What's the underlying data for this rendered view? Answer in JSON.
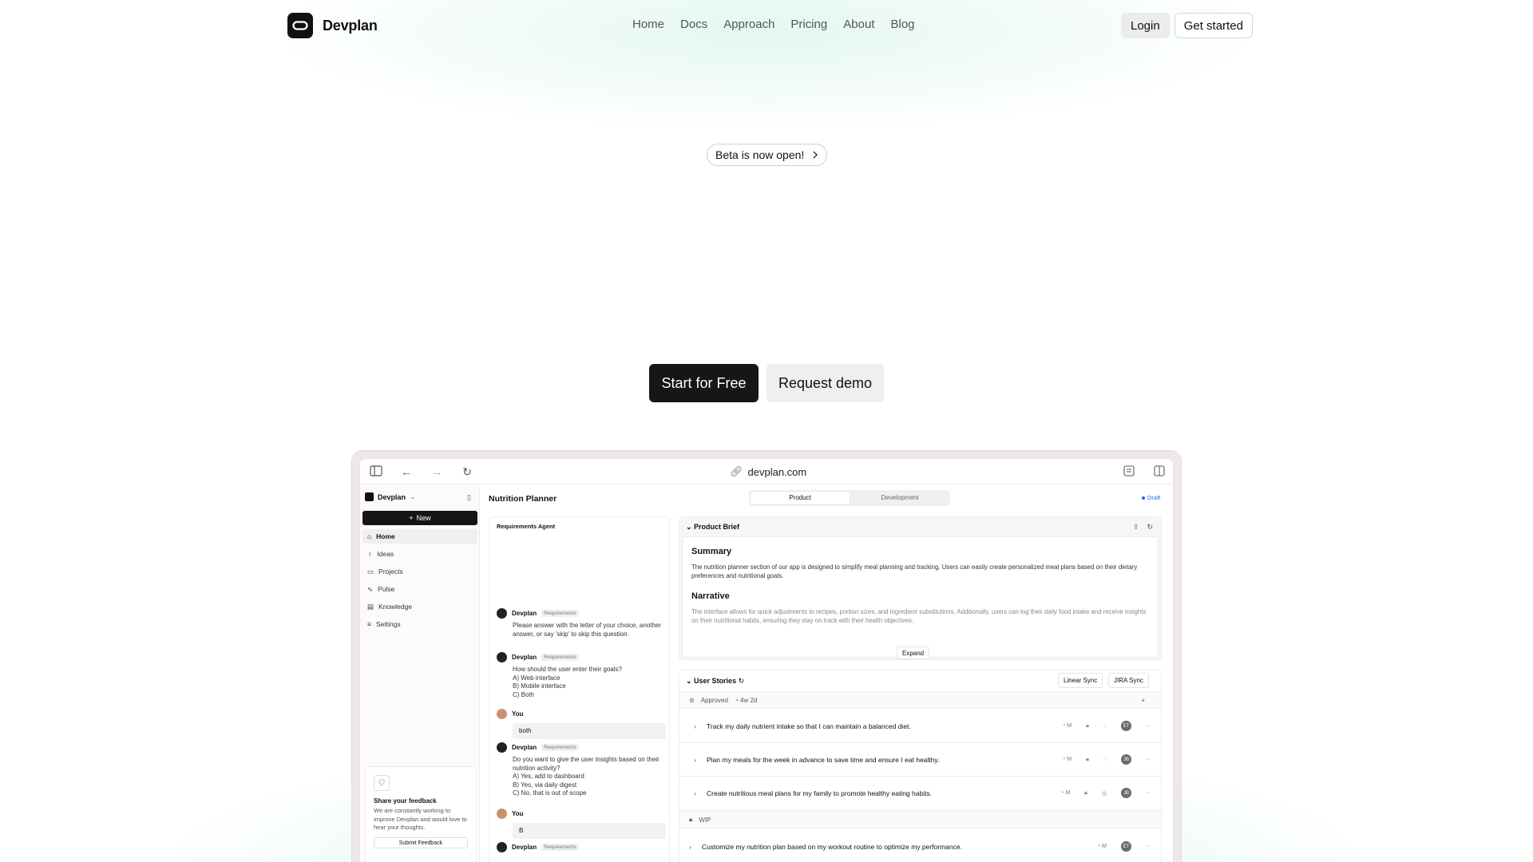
{
  "brand": {
    "name": "Devplan"
  },
  "nav": {
    "links": [
      "Home",
      "Docs",
      "Approach",
      "Pricing",
      "About",
      "Blog"
    ],
    "login": "Login",
    "get_started": "Get started"
  },
  "hero": {
    "beta_badge": "Beta is now open!",
    "cta_primary": "Start for Free",
    "cta_secondary": "Request demo"
  },
  "browser": {
    "url": "devplan.com"
  },
  "app": {
    "workspace": "Devplan",
    "new_button": "New",
    "sidebar": [
      "Home",
      "Ideas",
      "Projects",
      "Pulse",
      "Knowledge",
      "Settings"
    ],
    "feedback": {
      "title": "Share your feedback",
      "text": "We are constantly working to improve Devplan and would love to hear your thoughts.",
      "button": "Submit Feedback"
    },
    "page_title": "Nutrition Planner",
    "tabs": [
      "Product",
      "Development"
    ],
    "status": "Draft",
    "chat": {
      "header": "Requirements Agent",
      "messages": [
        {
          "who": "Devplan",
          "tag": "Requirements",
          "text": "Please answer with the letter of your choice, another answer, or say 'skip' to skip this question."
        },
        {
          "who": "Devplan",
          "tag": "Requirements",
          "text": "How should the user enter their goals?\nA) Web interface\nB) Mobile interface\nC) Both"
        },
        {
          "who": "You",
          "reply": "both"
        },
        {
          "who": "Devplan",
          "tag": "Requirements",
          "text": "Do you want to give the user insights based on their nutrition activity?\nA) Yes, add to dashboard\nB) Yes, via daily digest\nC) No, that is out of scope"
        },
        {
          "who": "You",
          "reply": "B"
        },
        {
          "who": "Devplan",
          "tag": "Requirements"
        }
      ]
    },
    "brief": {
      "header": "Product Brief",
      "summary_title": "Summary",
      "summary_text": "The nutrition planner section of our app is designed to simplify meal planning and tracking. Users can easily create personalized meal plans based on their dietary preferences and nutritional goals.",
      "narrative_title": "Narrative",
      "narrative_text": "The interface allows for quick adjustments to recipes, portion sizes, and ingredient substitutions. Additionally, users can log their daily food intake and receive insights on their nutritional habits, ensuring they stay on track with their health objectives.",
      "expand": "Expand"
    },
    "stories": {
      "header": "User Stories",
      "linear_sync": "Linear Sync",
      "jira_sync": "JIRA Sync",
      "groups": [
        {
          "label": "Approved",
          "age": "4w 2d"
        },
        {
          "label": "WIP"
        }
      ],
      "items": [
        {
          "text": "Track my daily nutrient intake so that I can maintain a balanced diet.",
          "size": "M",
          "assignee": "ET"
        },
        {
          "text": "Plan my meals for the week in advance to save time and ensure I eat healthy.",
          "size": "M",
          "assignee": "JB"
        },
        {
          "text": "Create nutritious meal plans for my family to promote healthy eating habits.",
          "size": "M",
          "assignee": "JB"
        },
        {
          "text": "Customize my nutrition plan based on my workout routine to optimize my performance.",
          "size": "M",
          "assignee": "ET"
        }
      ]
    }
  }
}
